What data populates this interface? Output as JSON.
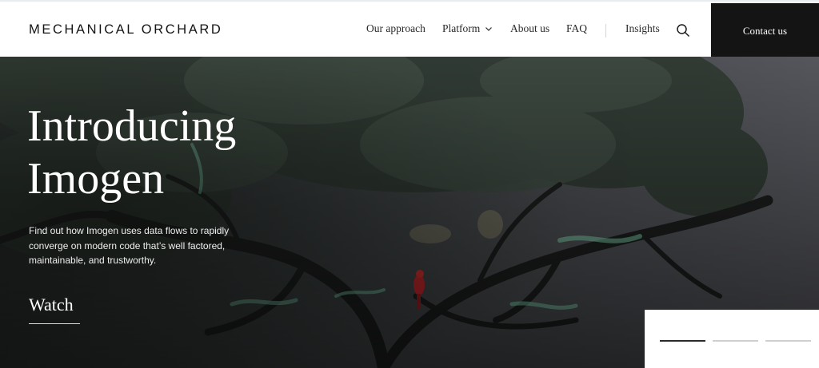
{
  "brand": {
    "logo_text": "MECHANICAL ORCHARD"
  },
  "nav": {
    "items": [
      {
        "label": "Our approach",
        "has_dropdown": false
      },
      {
        "label": "Platform",
        "has_dropdown": true
      },
      {
        "label": "About us",
        "has_dropdown": false
      },
      {
        "label": "FAQ",
        "has_dropdown": false
      },
      {
        "label": "Insights",
        "has_dropdown": false
      }
    ],
    "search_icon": "search-icon",
    "contact_label": "Contact us"
  },
  "hero": {
    "title_line1": "Introducing",
    "title_line2": "Imogen",
    "description": "Find out how Imogen uses data flows to rapidly converge on modern code that’s well factored, maintainable, and trustworthy.",
    "cta_label": "Watch"
  },
  "carousel": {
    "slide_count": 3,
    "active_index": 0
  },
  "colors": {
    "dark": "#141414",
    "accent_green": "#7fd6b0",
    "parrot_red": "#c8262a"
  }
}
